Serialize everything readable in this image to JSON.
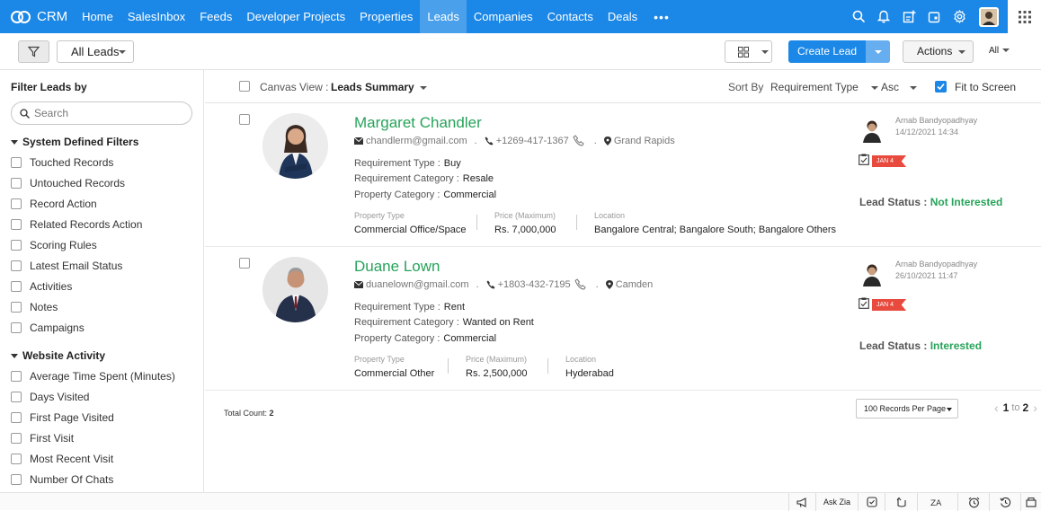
{
  "app": {
    "name": "CRM"
  },
  "nav": {
    "items": [
      {
        "label": "Home"
      },
      {
        "label": "SalesInbox"
      },
      {
        "label": "Feeds"
      },
      {
        "label": "Developer Projects"
      },
      {
        "label": "Properties"
      },
      {
        "label": "Leads"
      },
      {
        "label": "Companies"
      },
      {
        "label": "Contacts"
      },
      {
        "label": "Deals"
      }
    ],
    "active": "Leads",
    "more": "•••",
    "right_icons": [
      "search-icon",
      "bell-icon",
      "add-record-icon",
      "calendar-icon",
      "gear-icon",
      "user-avatar",
      "apps-grid-icon"
    ]
  },
  "toolbar": {
    "view_selector": "All Leads",
    "create_label": "Create Lead",
    "actions_label": "Actions",
    "all_label": "All"
  },
  "sidebar": {
    "title": "Filter Leads by",
    "search_placeholder": "Search",
    "system_section": "System Defined Filters",
    "system_filters": [
      "Touched Records",
      "Untouched Records",
      "Record Action",
      "Related Records Action",
      "Scoring Rules",
      "Latest Email Status",
      "Activities",
      "Notes",
      "Campaigns"
    ],
    "website_section": "Website Activity",
    "website_filters": [
      "Average Time Spent (Minutes)",
      "Days Visited",
      "First Page Visited",
      "First Visit",
      "Most Recent Visit",
      "Number Of Chats"
    ]
  },
  "content_bar": {
    "canvas_label": "Canvas View :",
    "canvas_value": "Leads Summary",
    "sort_by_label": "Sort By",
    "sort_field": "Requirement Type",
    "sort_dir": "Asc",
    "fit_label": "Fit to Screen",
    "fit_checked": true
  },
  "leads": [
    {
      "name": "Margaret Chandler",
      "email": "chandlerm@gmail.com",
      "phone": "+1269-417-1367",
      "location": "Grand Rapids",
      "req_type_label": "Requirement Type :",
      "req_type": "Buy",
      "req_cat_label": "Requirement Category :",
      "req_cat": "Resale",
      "prop_cat_label": "Property Category :",
      "prop_cat": "Commercial",
      "prop_type_label": "Property Type",
      "prop_type": "Commercial Office/Space",
      "price_label": "Price (Maximum)",
      "price": "Rs. 7,000,000",
      "loc_label": "Location",
      "loc": "Bangalore Central; Bangalore South; Bangalore Others",
      "owner": "Arnab Bandyopadhyay",
      "date": "14/12/2021 14:34",
      "task_tag": "JAN 4",
      "status_label": "Lead Status :",
      "status": "Not Interested"
    },
    {
      "name": "Duane Lown",
      "email": "duanelown@gmail.com",
      "phone": "+1803-432-7195",
      "location": "Camden",
      "req_type_label": "Requirement Type :",
      "req_type": "Rent",
      "req_cat_label": "Requirement Category :",
      "req_cat": "Wanted on Rent",
      "prop_cat_label": "Property Category :",
      "prop_cat": "Commercial",
      "prop_type_label": "Property Type",
      "prop_type": "Commercial Other",
      "price_label": "Price (Maximum)",
      "price": "Rs. 2,500,000",
      "loc_label": "Location",
      "loc": "Hyderabad",
      "owner": "Arnab Bandyopadhyay",
      "date": "26/10/2021 11:47",
      "task_tag": "JAN 4",
      "status_label": "Lead Status :",
      "status": "Interested"
    }
  ],
  "footer": {
    "total_label": "Total Count:",
    "total_value": "2",
    "per_page": "100 Records Per Page",
    "page_from": "1",
    "page_to_word": "to",
    "page_to": "2"
  },
  "bottombar": {
    "ask_zia": "Ask Zia",
    "icons": [
      "announcement-icon",
      "ask-zia",
      "quick-note-icon",
      "recent-items-icon",
      "translate-icon",
      "alarm-icon",
      "history-icon"
    ]
  }
}
